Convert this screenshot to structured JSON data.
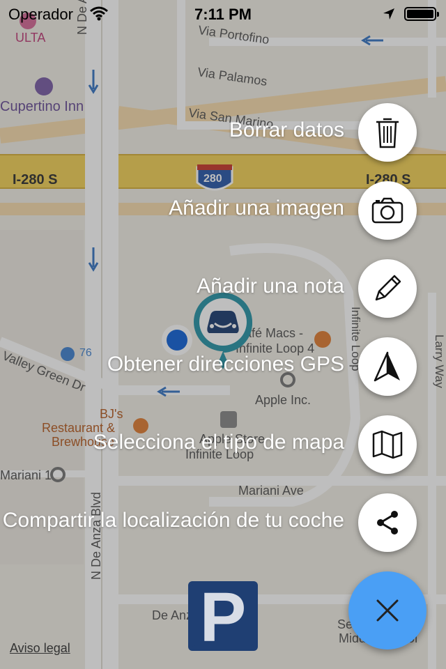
{
  "status_bar": {
    "carrier": "Operador",
    "time": "7:11 PM"
  },
  "map": {
    "labels": {
      "ulta": "ULTA",
      "cupertino_inn": "Cupertino Inn",
      "n_de_anza_top": "N De Anza",
      "via_portofino": "Via Portofino",
      "via_palamos": "Via Palamos",
      "via_san_marino": "Via San Marino",
      "i280_left": "I-280 S",
      "i280_right": "I-280 S",
      "i280_shield": "280",
      "cafe_macs_1": "Café Macs -",
      "cafe_macs_2": "Infinite Loop 4",
      "infinite_loop_v": "Infinite Loop",
      "larry_way": "Larry Way",
      "valley_green": "Valley Green Dr",
      "gas_76": "76",
      "apple_inc": "Apple Inc.",
      "bjs_1": "BJ's",
      "bjs_2": "Restaurant &",
      "bjs_3": "Brewhouse",
      "apple_store_1": "Apple Store",
      "apple_store_2": "Infinite Loop",
      "mariani_1": "Mariani 1",
      "mariani_ave": "Mariani Ave",
      "n_de_anza_blvd": "N De Anza Blvd",
      "de_anza_bottom": "De Anza",
      "school_1": "Sedgwick",
      "school_2": "Middle School"
    }
  },
  "actions": [
    {
      "label": "Borrar datos",
      "icon": "trash-icon"
    },
    {
      "label": "Añadir una imagen",
      "icon": "camera-icon"
    },
    {
      "label": "Añadir una nota",
      "icon": "pencil-icon"
    },
    {
      "label": "Obtener direcciones GPS",
      "icon": "navigation-arrow-icon"
    },
    {
      "label": "Selecciona el tipo de mapa",
      "icon": "map-icon"
    },
    {
      "label": "Compartir la localización de tu coche",
      "icon": "share-icon"
    }
  ],
  "fab": {
    "icon": "close-icon",
    "color": "#4a9ff5"
  },
  "footer": {
    "legal": "Aviso legal",
    "parking_letter": "P"
  },
  "colors": {
    "highway": "#f3d25a",
    "fab": "#4a9ff5",
    "pin": "#2a95a8",
    "user_location": "#1565d8",
    "parking_bg": "#1f3f73"
  }
}
